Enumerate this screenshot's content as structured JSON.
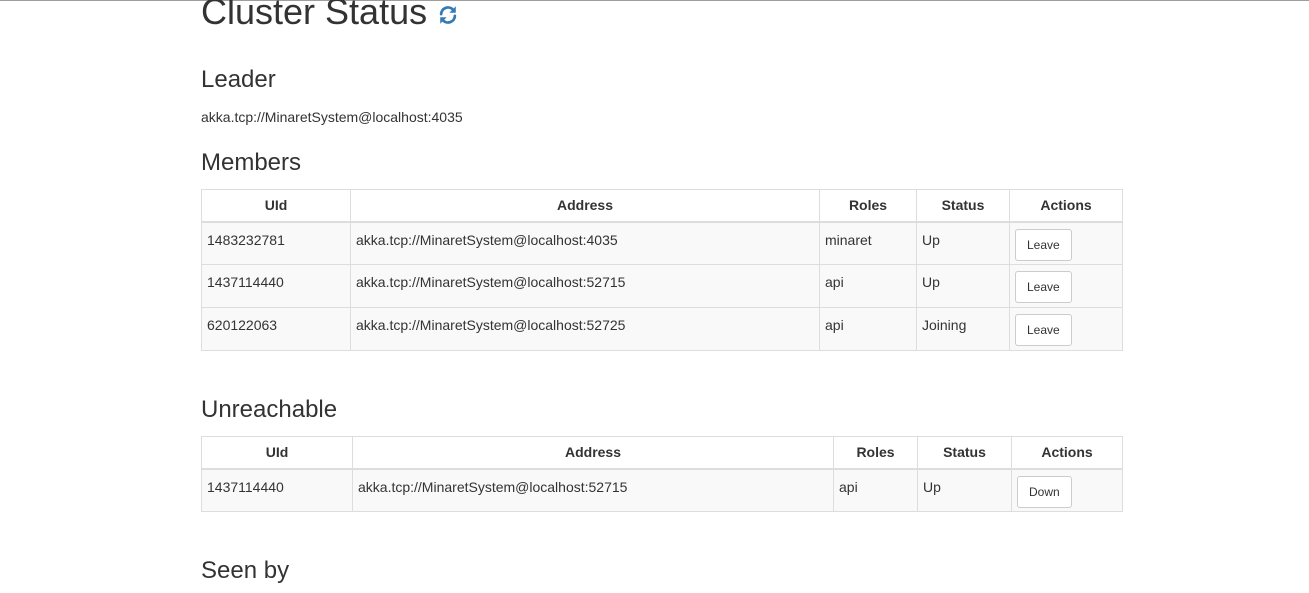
{
  "title": "Cluster Status",
  "icons": {
    "refresh": "refresh-icon",
    "refresh_color": "#337ab7"
  },
  "leader": {
    "heading": "Leader",
    "address": "akka.tcp://MinaretSystem@localhost:4035"
  },
  "members": {
    "heading": "Members",
    "columns": [
      "UId",
      "Address",
      "Roles",
      "Status",
      "Actions"
    ],
    "rows": [
      {
        "uid": "1483232781",
        "address": "akka.tcp://MinaretSystem@localhost:4035",
        "roles": "minaret",
        "status": "Up",
        "action": "Leave"
      },
      {
        "uid": "1437114440",
        "address": "akka.tcp://MinaretSystem@localhost:52715",
        "roles": "api",
        "status": "Up",
        "action": "Leave"
      },
      {
        "uid": "620122063",
        "address": "akka.tcp://MinaretSystem@localhost:52725",
        "roles": "api",
        "status": "Joining",
        "action": "Leave"
      }
    ]
  },
  "unreachable": {
    "heading": "Unreachable",
    "columns": [
      "UId",
      "Address",
      "Roles",
      "Status",
      "Actions"
    ],
    "rows": [
      {
        "uid": "1437114440",
        "address": "akka.tcp://MinaretSystem@localhost:52715",
        "roles": "api",
        "status": "Up",
        "action": "Down"
      }
    ]
  },
  "seen_by": {
    "heading": "Seen by"
  }
}
